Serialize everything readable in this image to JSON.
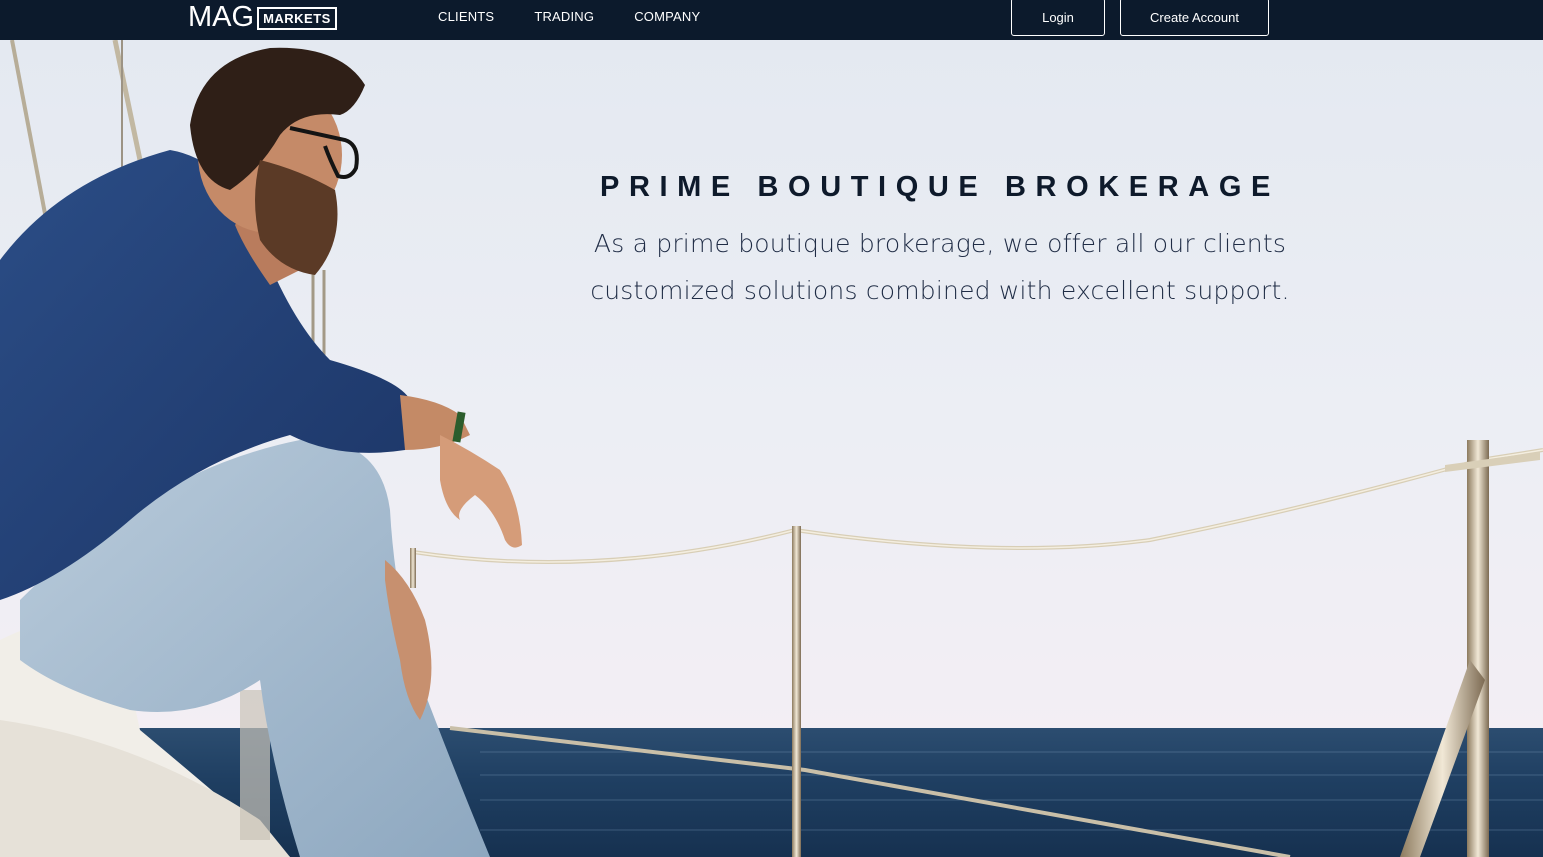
{
  "nav": {
    "logo_text": "MAG",
    "logo_box_text": "MARKETS",
    "links": [
      {
        "label": "CLIENTS"
      },
      {
        "label": "TRADING"
      },
      {
        "label": "COMPANY"
      }
    ],
    "login_label": "Login",
    "create_account_label": "Create Account"
  },
  "hero": {
    "title": "PRIME BOUTIQUE BROKERAGE",
    "subtitle_line1": "As a prime boutique brokerage, we offer all our clients",
    "subtitle_line2": "customized solutions combined with excellent support."
  },
  "colors": {
    "nav_bg": "#0c1a2c",
    "title": "#0e1a2b",
    "subtitle": "#1f2c45",
    "sky": "#e9edf3",
    "sea": "#1e3f63"
  }
}
